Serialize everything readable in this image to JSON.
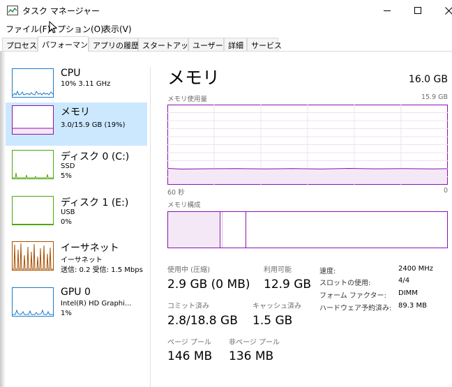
{
  "window": {
    "title": "タスク マネージャー"
  },
  "menu": [
    "ファイル(F)",
    "オプション(O)",
    "表示(V)"
  ],
  "tabs": [
    "プロセス",
    "パフォーマンス",
    "アプリの履歴",
    "スタートアップ",
    "ユーザー",
    "詳細",
    "サービス"
  ],
  "resources": [
    {
      "name": "CPU",
      "line1": "10%  3.11 GHz",
      "line2": "",
      "color": "#1979ca"
    },
    {
      "name": "メモリ",
      "line1": "3.0/15.9 GB (19%)",
      "line2": "",
      "color": "#8b12ae"
    },
    {
      "name": "ディスク 0 (C:)",
      "line1": "SSD",
      "line2": "5%",
      "color": "#4da60c"
    },
    {
      "name": "ディスク 1 (E:)",
      "line1": "USB",
      "line2": "0%",
      "color": "#4da60c"
    },
    {
      "name": "イーサネット",
      "line1": "イーサネット",
      "line2": "送信: 0.2  受信: 1.5 Mbps",
      "color": "#a74f01"
    },
    {
      "name": "GPU 0",
      "line1": "Intel(R) HD Graphi...",
      "line2": "1%",
      "color": "#1979ca"
    }
  ],
  "main": {
    "title": "メモリ",
    "total": "16.0 GB",
    "usage_label": "メモリ使用量",
    "usage_max": "15.9 GB",
    "axis_left": "60 秒",
    "axis_right": "0",
    "composition_label": "メモリ構成",
    "accent_color": "#8b12ae",
    "usage_percent": 19,
    "stats": {
      "in_use_label": "使用中 (圧縮)",
      "in_use_value": "2.9 GB (0 MB)",
      "available_label": "利用可能",
      "available_value": "12.9 GB",
      "committed_label": "コミット済み",
      "committed_value": "2.8/18.8 GB",
      "cached_label": "キャッシュ済み",
      "cached_value": "1.5 GB",
      "paged_label": "ページ プール",
      "paged_value": "146 MB",
      "nonpaged_label": "非ページ プール",
      "nonpaged_value": "136 MB"
    },
    "details": [
      {
        "label": "速度:",
        "value": "2400 MHz"
      },
      {
        "label": "スロットの使用:",
        "value": "4/4"
      },
      {
        "label": "フォーム ファクター:",
        "value": "DIMM"
      },
      {
        "label": "ハードウェア予約済み:",
        "value": "89.3 MB"
      }
    ]
  }
}
